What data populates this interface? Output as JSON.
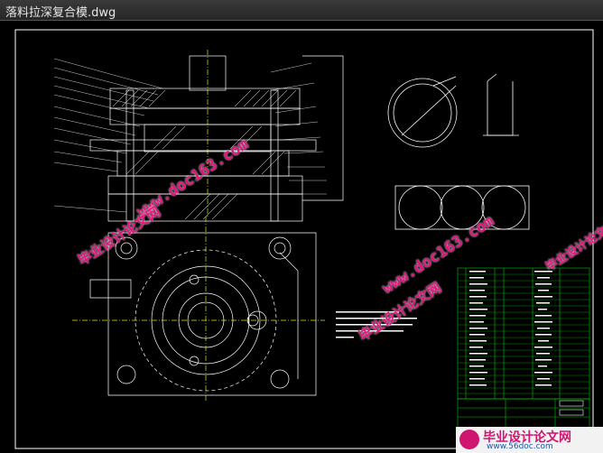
{
  "window": {
    "title": "落料拉深复合模.dwg"
  },
  "watermarks": {
    "site_cn": "毕业设计论文网",
    "site_url": "www.doc163.com"
  },
  "branding": {
    "cn": "毕业设计论文网",
    "url": "www.56doc.com"
  },
  "drawing": {
    "colors": {
      "background": "#000000",
      "lines": "#ffffff",
      "centerline": "#e6e600",
      "table": "#00ff00"
    }
  }
}
